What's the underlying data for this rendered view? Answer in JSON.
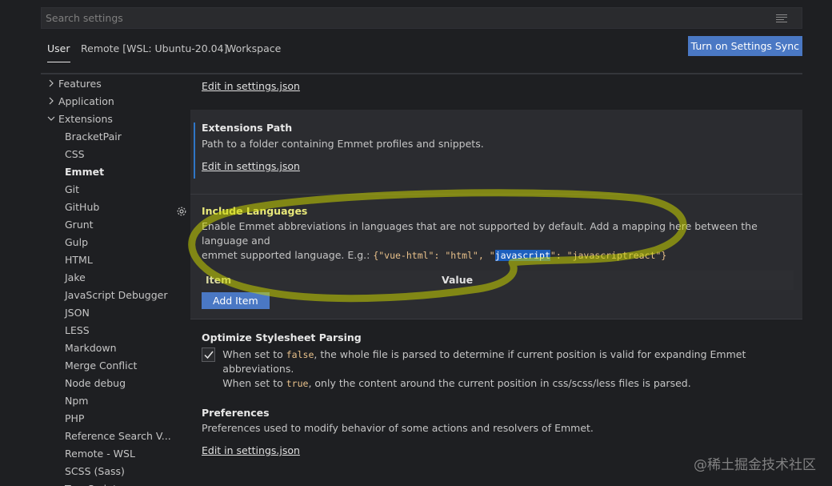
{
  "search": {
    "placeholder": "Search settings"
  },
  "tabs": [
    {
      "label": "User",
      "active": true
    },
    {
      "label": "Remote [WSL: Ubuntu-20.04]",
      "active": false
    },
    {
      "label": "Workspace",
      "active": false
    }
  ],
  "sync_button": "Turn on Settings Sync",
  "sidebar": {
    "top_items": [
      {
        "label": "Features",
        "expanded": false
      },
      {
        "label": "Application",
        "expanded": false
      },
      {
        "label": "Extensions",
        "expanded": true
      }
    ],
    "extensions": [
      "BracketPair",
      "CSS",
      "Emmet",
      "Git",
      "GitHub",
      "Grunt",
      "Gulp",
      "HTML",
      "Jake",
      "JavaScript Debugger",
      "JSON",
      "LESS",
      "Markdown",
      "Merge Conflict",
      "Node debug",
      "Npm",
      "PHP",
      "Reference Search V...",
      "Remote - WSL",
      "SCSS (Sass)",
      "TypeScript"
    ],
    "selected": "Emmet"
  },
  "content": {
    "top_link": "Edit in settings.json",
    "extensions_path": {
      "title": "Extensions Path",
      "description": "Path to a folder containing Emmet profiles and snippets.",
      "link": "Edit in settings.json"
    },
    "include_languages": {
      "title": "Include Languages",
      "description_line1": "Enable Emmet abbreviations in languages that are not supported by default. Add a mapping here between the language and",
      "description_line2_prefix": "emmet supported language. E.g.: ",
      "code_part1": "{\"vue-html\": \"html\", \"",
      "code_highlight": "javascript",
      "code_part2": "\": \"javascriptreact\"}",
      "col_item": "Item",
      "col_value": "Value",
      "add_button": "Add Item"
    },
    "optimize": {
      "title": "Optimize Stylesheet Parsing",
      "checked": true,
      "line1_a": "When set to ",
      "line1_code": "false",
      "line1_b": ", the whole file is parsed to determine if current position is valid for expanding Emmet abbreviations.",
      "line2_a": "When set to ",
      "line2_code": "true",
      "line2_b": ", only the content around the current position in css/scss/less files is parsed."
    },
    "preferences": {
      "title": "Preferences",
      "description": "Preferences used to modify behavior of some actions and resolvers of Emmet.",
      "link": "Edit in settings.json"
    }
  },
  "watermark": "@稀土掘金技术社区",
  "colors": {
    "accent": "#4a78c4",
    "annotation": "#c8d400",
    "background": "#1e1f22"
  }
}
